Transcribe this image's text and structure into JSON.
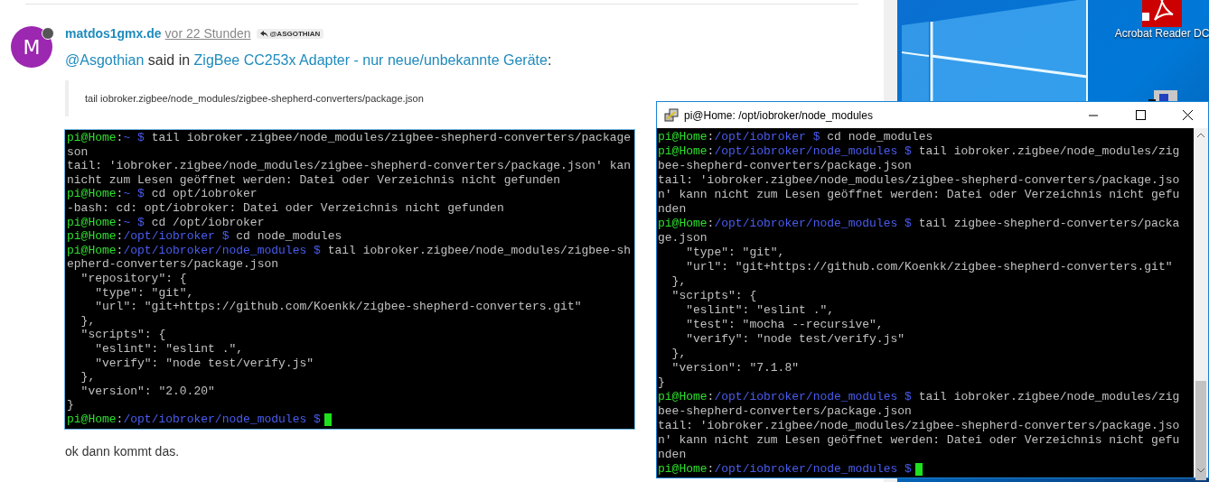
{
  "post": {
    "avatar_letter": "M",
    "author": "matdos1gmx.de",
    "time": "vor 22 Stunden",
    "reply_to": "@ASGOTHIAN",
    "quote_intro": {
      "mention": "@Asgothian",
      "said": "said in",
      "topic": "ZigBee CC253x Adapter - nur neue/unbekannte Geräte",
      "colon": ":"
    },
    "blockquote": "tail iobroker.zigbee/node_modules/zigbee-shepherd-converters/package.json",
    "terminal_lines": [
      {
        "kind": "prompt",
        "host": "pi@Home",
        "sep": ":",
        "path": "~ $",
        "command": "tail iobroker.zigbee/node_modules/zigbee-shepherd-converters/package"
      },
      {
        "kind": "output",
        "text": "son"
      },
      {
        "kind": "output",
        "text": "tail: 'iobroker.zigbee/node_modules/zigbee-shepherd-converters/package.json' kan"
      },
      {
        "kind": "output",
        "text": "nicht zum Lesen geöffnet werden: Datei oder Verzeichnis nicht gefunden"
      },
      {
        "kind": "prompt",
        "host": "pi@Home",
        "sep": ":",
        "path": "~ $",
        "command": "cd opt/iobroker"
      },
      {
        "kind": "output",
        "text": "-bash: cd: opt/iobroker: Datei oder Verzeichnis nicht gefunden"
      },
      {
        "kind": "prompt",
        "host": "pi@Home",
        "sep": ":",
        "path": "~ $",
        "command": "cd /opt/iobroker"
      },
      {
        "kind": "prompt",
        "host": "pi@Home",
        "sep": ":",
        "path": "/opt/iobroker $",
        "command": "cd node_modules"
      },
      {
        "kind": "prompt",
        "host": "pi@Home",
        "sep": ":",
        "path": "/opt/iobroker/node_modules $",
        "command": "tail iobroker.zigbee/node_modules/zigbee-sh"
      },
      {
        "kind": "output",
        "text": "epherd-converters/package.json"
      },
      {
        "kind": "output",
        "text": "  \"repository\": {"
      },
      {
        "kind": "output",
        "text": "    \"type\": \"git\","
      },
      {
        "kind": "output",
        "text": "    \"url\": \"git+https://github.com/Koenkk/zigbee-shepherd-converters.git\""
      },
      {
        "kind": "output",
        "text": "  },"
      },
      {
        "kind": "output",
        "text": "  \"scripts\": {"
      },
      {
        "kind": "output",
        "text": "    \"eslint\": \"eslint .\","
      },
      {
        "kind": "output",
        "text": "    \"verify\": \"node test/verify.js\""
      },
      {
        "kind": "output",
        "text": "  },"
      },
      {
        "kind": "output",
        "text": "  \"version\": \"2.0.20\""
      },
      {
        "kind": "output",
        "text": "}"
      },
      {
        "kind": "cursor_prompt",
        "host": "pi@Home",
        "sep": ":",
        "path": "/opt/iobroker/node_modules $"
      }
    ],
    "body": "ok dann kommt das."
  },
  "desktop": {
    "icons": [
      {
        "label": "Acrobat Reader DC"
      }
    ]
  },
  "terminal_window": {
    "title": "pi@Home: /opt/iobroker/node_modules",
    "lines": [
      {
        "kind": "prompt",
        "host": "pi@Home",
        "sep": ":",
        "path": "/opt/iobroker $",
        "command": "cd node_modules"
      },
      {
        "kind": "prompt",
        "host": "pi@Home",
        "sep": ":",
        "path": "/opt/iobroker/node_modules $",
        "command": "tail iobroker.zigbee/node_modules/zig"
      },
      {
        "kind": "output",
        "text": "bee-shepherd-converters/package.json"
      },
      {
        "kind": "output",
        "text": "tail: 'iobroker.zigbee/node_modules/zigbee-shepherd-converters/package.jso"
      },
      {
        "kind": "output",
        "text": "n' kann nicht zum Lesen geöffnet werden: Datei oder Verzeichnis nicht gefu"
      },
      {
        "kind": "output",
        "text": "nden"
      },
      {
        "kind": "prompt",
        "host": "pi@Home",
        "sep": ":",
        "path": "/opt/iobroker/node_modules $",
        "command": "tail zigbee-shepherd-converters/packa"
      },
      {
        "kind": "output",
        "text": "ge.json"
      },
      {
        "kind": "output",
        "text": "    \"type\": \"git\","
      },
      {
        "kind": "output",
        "text": "    \"url\": \"git+https://github.com/Koenkk/zigbee-shepherd-converters.git\""
      },
      {
        "kind": "output",
        "text": "  },"
      },
      {
        "kind": "output",
        "text": "  \"scripts\": {"
      },
      {
        "kind": "output",
        "text": "    \"eslint\": \"eslint .\","
      },
      {
        "kind": "output",
        "text": "    \"test\": \"mocha --recursive\","
      },
      {
        "kind": "output",
        "text": "    \"verify\": \"node test/verify.js\""
      },
      {
        "kind": "output",
        "text": "  },"
      },
      {
        "kind": "output",
        "text": "  \"version\": \"7.1.8\""
      },
      {
        "kind": "output",
        "text": "}"
      },
      {
        "kind": "prompt",
        "host": "pi@Home",
        "sep": ":",
        "path": "/opt/iobroker/node_modules $",
        "command": "tail iobroker.zigbee/node_modules/zig"
      },
      {
        "kind": "output",
        "text": "bee-shepherd-converters/package.json"
      },
      {
        "kind": "output",
        "text": "tail: 'iobroker.zigbee/node_modules/zigbee-shepherd-converters/package.jso"
      },
      {
        "kind": "output",
        "text": "n' kann nicht zum Lesen geöffnet werden: Datei oder Verzeichnis nicht gefu"
      },
      {
        "kind": "output",
        "text": "nden"
      },
      {
        "kind": "cursor_prompt",
        "host": "pi@Home",
        "sep": ":",
        "path": "/opt/iobroker/node_modules $"
      }
    ]
  }
}
